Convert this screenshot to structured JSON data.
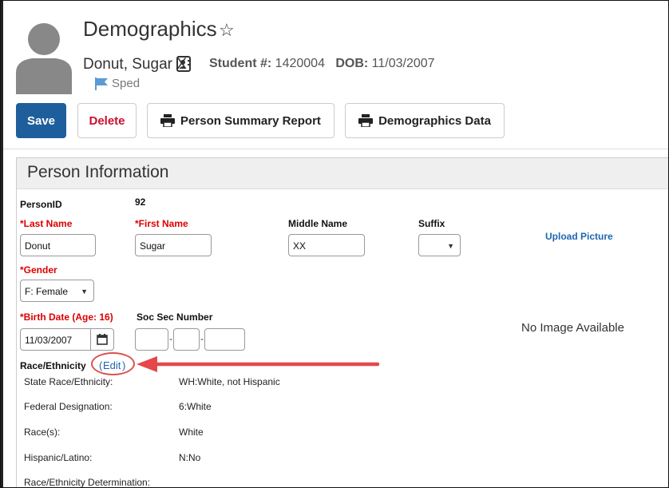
{
  "header": {
    "title": "Demographics",
    "star_icon": "☆",
    "person_name": "Donut, Sugar X",
    "student_number_label": "Student #:",
    "student_number": "1420004",
    "dob_label": "DOB:",
    "dob": "11/03/2007",
    "flag_label": "Sped",
    "flag_color": "#5b9bd5"
  },
  "toolbar": {
    "save_label": "Save",
    "delete_label": "Delete",
    "person_summary_label": "Person Summary Report",
    "demographics_data_label": "Demographics Data",
    "save_color": "#1f5e9c",
    "delete_color": "#c8102e"
  },
  "panel": {
    "title": "Person Information",
    "person_id_label": "PersonID",
    "person_id": "92",
    "last_name_label": "*Last Name",
    "last_name": "Donut",
    "first_name_label": "*First Name",
    "first_name": "Sugar",
    "middle_name_label": "Middle Name",
    "middle_name": "XX",
    "suffix_label": "Suffix",
    "suffix": "",
    "upload_picture_label": "Upload Picture",
    "gender_label": "*Gender",
    "gender": "F: Female",
    "birth_date_label": "*Birth Date (Age: 16)",
    "birth_date": "11/03/2007",
    "ssn_label": "Soc Sec Number",
    "no_image_label": "No Image Available",
    "race_label": "Race/Ethnicity",
    "edit_label": "Edit",
    "race_rows": [
      {
        "label": "State Race/Ethnicity:",
        "value": "WH:White, not Hispanic"
      },
      {
        "label": "Federal Designation:",
        "value": "6:White"
      },
      {
        "label": "Race(s):",
        "value": "White"
      },
      {
        "label": "Hispanic/Latino:",
        "value": "N:No"
      },
      {
        "label": "Race/Ethnicity Determination:",
        "value": ""
      }
    ]
  },
  "annotation": {
    "highlight_color": "#d9534f"
  }
}
